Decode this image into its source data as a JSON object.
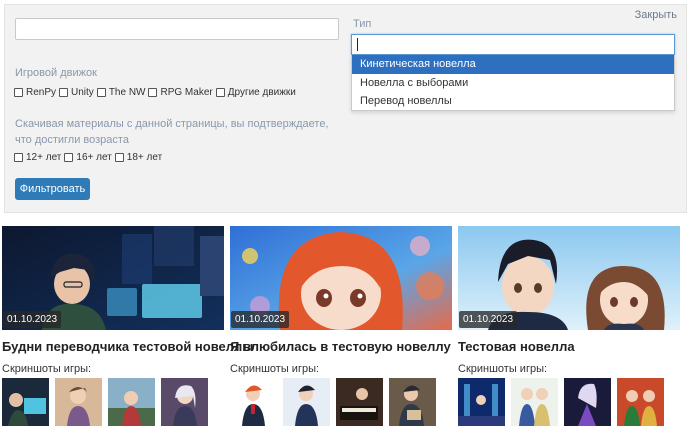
{
  "filter": {
    "close_label": "Закрыть",
    "search_value": "",
    "type_label": "Тип",
    "type_input_value": "",
    "type_options": [
      "Кинетическая новелла",
      "Новелла с выборами",
      "Перевод новеллы"
    ],
    "engine_label": "Игровой движок",
    "engines": [
      "RenPy",
      "Unity",
      "The NW",
      "RPG Maker",
      "Другие движки"
    ],
    "age_notice": "Скачивая материалы с данной страницы, вы подтверждаете, что достигли возраста",
    "ages": [
      "12+ лет",
      "16+ лет",
      "18+ лет"
    ],
    "filter_button": "Фильтровать"
  },
  "cards": [
    {
      "date": "01.10.2023",
      "title": "Будни переводчика тестовой новеллы",
      "screens_label": "Скриншоты игры:"
    },
    {
      "date": "01.10.2023",
      "title": "Я влюбилась в тестовую новеллу",
      "screens_label": "Скриншоты игры:"
    },
    {
      "date": "01.10.2023",
      "title": "Тестовая новелла",
      "screens_label": "Скриншоты игры:"
    }
  ],
  "colors": {
    "accent": "#2e7bb8",
    "dropdown_active": "#2f6fbf",
    "panel_bg": "#f2f2f2"
  }
}
